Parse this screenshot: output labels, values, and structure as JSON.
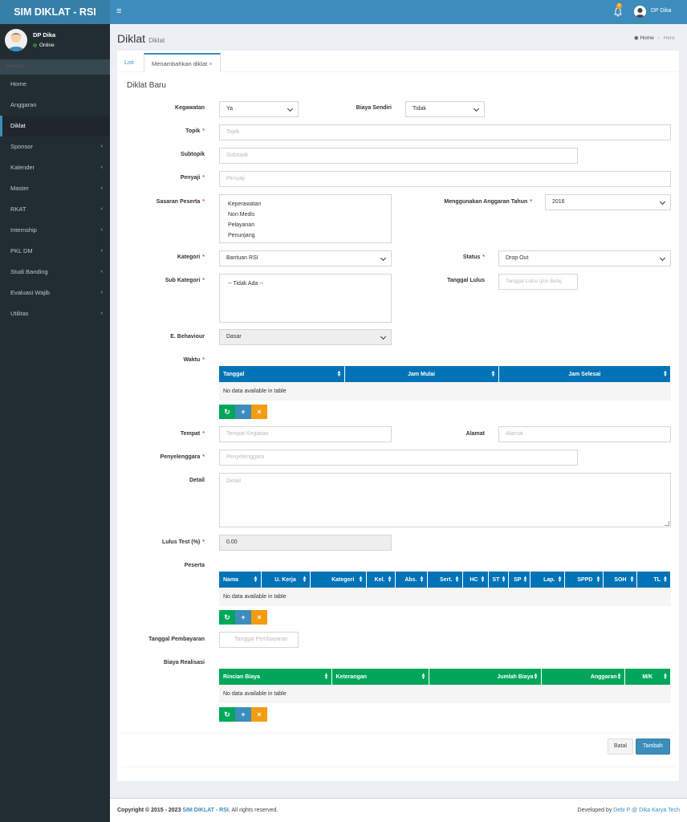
{
  "app": {
    "logo": "SIM DIKLAT - RSI",
    "menu_icon": "hamburger-icon"
  },
  "topbar": {
    "notif_count": "0",
    "user_name": "DP Dika"
  },
  "sidebar": {
    "user_name": "DP Dika",
    "status": "Online",
    "search_placeholder": "Search...",
    "items": [
      {
        "label": "Home",
        "chevron": ""
      },
      {
        "label": "Anggaran",
        "chevron": ""
      },
      {
        "label": "Diklat",
        "chevron": ""
      },
      {
        "label": "Sponsor",
        "chevron": "‹"
      },
      {
        "label": "Kalender",
        "chevron": "‹"
      },
      {
        "label": "Master",
        "chevron": "‹"
      },
      {
        "label": "RKAT",
        "chevron": "‹"
      },
      {
        "label": "Internship",
        "chevron": "‹"
      },
      {
        "label": "PKL DM",
        "chevron": "‹"
      },
      {
        "label": "Studi Banding",
        "chevron": "‹"
      },
      {
        "label": "Evaluasi Wajib",
        "chevron": "‹"
      },
      {
        "label": "Utilitas",
        "chevron": "‹"
      }
    ]
  },
  "header": {
    "title": "Diklat",
    "subtitle": "Diklat",
    "breadcrumb_home": "Home",
    "breadcrumb_current": "Here"
  },
  "tabs": {
    "list": "List",
    "active": "Menambahkan diklat",
    "close": "×"
  },
  "form": {
    "title": "Diklat Baru",
    "kegawatan": {
      "label": "Kegawatan",
      "value": "Ya"
    },
    "biaya_sendiri": {
      "label": "Biaya Sendiri",
      "value": "Tidak"
    },
    "topik": {
      "label": "Topik",
      "placeholder": "Topik"
    },
    "subtopik": {
      "label": "Subtopik",
      "placeholder": "Subtopik"
    },
    "penyaji": {
      "label": "Penyaji",
      "placeholder": "Penyaji"
    },
    "sasaran": {
      "label": "Sasaran Peserta",
      "options": [
        "Keperawatan",
        "Non Medis",
        "Pelayanan",
        "Penunjang"
      ]
    },
    "anggaran_tahun": {
      "label": "Menggunakan Anggaran Tahun",
      "value": "2016"
    },
    "kategori": {
      "label": "Kategori",
      "value": "Bantuan RSI"
    },
    "status": {
      "label": "Status",
      "value": "Drop Out"
    },
    "sub_kategori": {
      "label": "Sub Kategori",
      "value": "-- Tidak Ada --"
    },
    "tanggal_lulus": {
      "label": "Tanggal Lulus",
      "placeholder": "Tanggal Lulus Ijzin Belaj"
    },
    "behaviour": {
      "label": "E. Behaviour",
      "value": "Dasar"
    },
    "waktu": {
      "label": "Waktu",
      "columns": [
        "Tanggal",
        "Jam Mulai",
        "Jam Selesai"
      ],
      "empty": "No data available in table"
    },
    "tempat": {
      "label": "Tempat",
      "placeholder": "Tempat Kegiatan"
    },
    "alamat": {
      "label": "Alamat",
      "placeholder": "Alamat"
    },
    "penyelenggara": {
      "label": "Penyelenggara",
      "placeholder": "Penyelenggara"
    },
    "detail": {
      "label": "Detail",
      "placeholder": "Detail"
    },
    "lulus_test": {
      "label": "Lulus Test (%)",
      "value": "0.00"
    },
    "peserta": {
      "label": "Peserta",
      "columns": [
        "Nama",
        "U. Kerja",
        "Kategori",
        "Kel.",
        "Abs.",
        "Sert.",
        "HC",
        "ST",
        "SP",
        "Lap.",
        "SPPD",
        "SOH",
        "TL"
      ],
      "empty": "No data available in table"
    },
    "tanggal_pembayaran": {
      "label": "Tanggal Pembayaran",
      "placeholder": "Tanggal Pembayaran"
    },
    "biaya_realisasi": {
      "label": "Biaya Realisasi",
      "columns": [
        "Rincian Biaya",
        "Keterangan",
        "Jumlah Biaya",
        "Anggaran",
        "M/K"
      ],
      "empty": "No data available in table"
    },
    "buttons": {
      "refresh": "↻",
      "add": "+",
      "remove": "×"
    },
    "cancel": "Batal",
    "submit": "Tambah",
    "req": "*"
  },
  "footer": {
    "copyright": "Copyright © 2015 - 2023",
    "brand": "SIM DIKLAT - RSI.",
    "rights": "All rights reserved.",
    "dev_prefix": "Developed by",
    "developer": "Debi P @ Dika Karya Tech"
  }
}
